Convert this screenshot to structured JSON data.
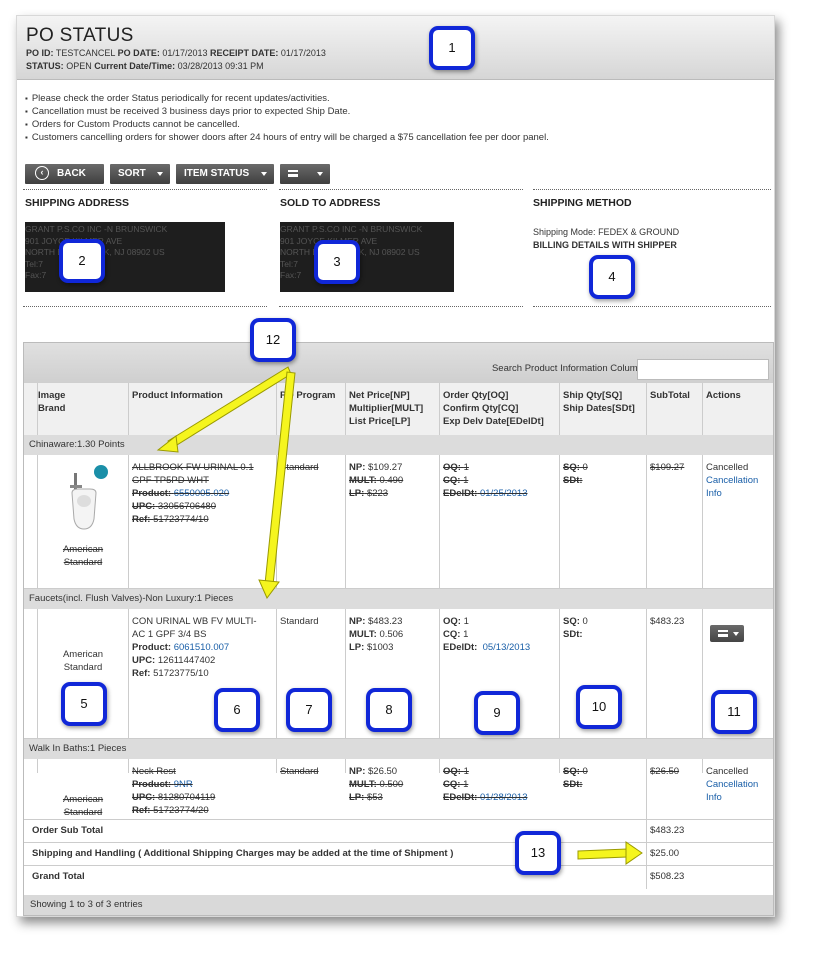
{
  "header": {
    "title": "PO STATUS",
    "po_id_label": "PO ID:",
    "po_id": "TESTCANCEL",
    "po_date_label": "PO DATE:",
    "po_date": "01/17/2013",
    "receipt_date_label": "RECEIPT DATE:",
    "receipt_date": "01/17/2013",
    "status_label": "STATUS:",
    "status": "OPEN",
    "current_label": "Current Date/Time:",
    "current": "03/28/2013 09:31 PM"
  },
  "notes": [
    "Please check the order Status periodically for recent updates/activities.",
    "Cancellation must be received 3 business days prior to expected Ship Date.",
    "Orders for Custom Products cannot be cancelled.",
    "Customers cancelling orders for shower doors after 24 hours of entry will be charged a $75 cancellation fee per door panel."
  ],
  "toolbar": {
    "back": "BACK",
    "sort": "SORT",
    "item_status": "ITEM STATUS"
  },
  "sections": {
    "shipping_address": "SHIPPING ADDRESS",
    "sold_to_address": "SOLD TO ADDRESS",
    "shipping_method": "SHIPPING METHOD",
    "shipping_addr_text": "GRANT P.S.CO INC -N BRUNSWICK\n901 JOYCE KILMER AVE\nNORTH BRUNSWICK, NJ 08902 US\nTel:7\nFax:7",
    "sold_to_addr_text": "GRANT P.S.CO INC -N BRUNSWICK\n901 JOYCE KILMER AVE\nNORTH BRUNSWICK, NJ 08902 US\nTel:7\nFax:7",
    "shipping_mode_label": "Shipping Mode:",
    "shipping_mode": "FEDEX & GROUND",
    "billing": "BILLING DETAILS WITH SHIPPER"
  },
  "table": {
    "search_label": "Search Product Information Column",
    "search_value": "",
    "columns": {
      "image_brand": [
        "Image",
        "Brand"
      ],
      "product_info": "Product Information",
      "po_program": "PO Program",
      "price": [
        "Net Price[NP]",
        "Multiplier[MULT]",
        "List Price[LP]"
      ],
      "order_qty": [
        "Order Qty[OQ]",
        "Confirm Qty[CQ]",
        "Exp Delv Date[EDelDt]"
      ],
      "ship_qty": [
        "Ship Qty[SQ]",
        "Ship Dates[SDt]"
      ],
      "subtotal": "SubTotal",
      "actions": "Actions"
    },
    "groups": [
      {
        "label": "Chinaware:1.30 Points",
        "brand": [
          "American",
          "Standard"
        ],
        "product": [
          "ALLBROOK FW URINAL 0.1",
          "GPF TP5PD WHT"
        ],
        "product_no_label": "Product:",
        "product_no": "6550005.020",
        "upc_label": "UPC:",
        "upc": "33056706480",
        "ref_label": "Ref:",
        "ref": "51723774/10",
        "program": "Standard",
        "np_label": "NP:",
        "np": "$109.27",
        "mult_label": "MULT:",
        "mult": "0.490",
        "lp_label": "LP:",
        "lp": "$223",
        "oq_label": "OQ:",
        "oq": "1",
        "cq_label": "CQ:",
        "cq": "1",
        "edeldt_label": "EDelDt:",
        "edeldt": "01/25/2013",
        "sq_label": "SQ:",
        "sq": "0",
        "sdt_label": "SDt:",
        "subtotal": "$109.27",
        "action_status": "Cancelled",
        "action_link": "Cancellation Info"
      },
      {
        "label": "Faucets(incl. Flush Valves)-Non Luxury:1 Pieces",
        "brand": [
          "American",
          "Standard"
        ],
        "product": [
          "CON URINAL WB FV MULTI-",
          "AC 1 GPF 3/4 BS"
        ],
        "product_no_label": "Product:",
        "product_no": "6061510.007",
        "upc_label": "UPC:",
        "upc": "12611447402",
        "ref_label": "Ref:",
        "ref": "51723775/10",
        "program": "Standard",
        "np_label": "NP:",
        "np": "$483.23",
        "mult_label": "MULT:",
        "mult": "0.506",
        "lp_label": "LP:",
        "lp": "$1003",
        "oq_label": "OQ:",
        "oq": "1",
        "cq_label": "CQ:",
        "cq": "1",
        "edeldt_label": "EDelDt:",
        "edeldt": "05/13/2013",
        "sq_label": "SQ:",
        "sq": "0",
        "sdt_label": "SDt:",
        "subtotal": "$483.23"
      },
      {
        "label": "Walk In Baths:1 Pieces",
        "brand": [
          "American",
          "Standard"
        ],
        "product": [
          "Neck Rest"
        ],
        "product_no_label": "Product:",
        "product_no": "9NR",
        "upc_label": "UPC:",
        "upc": "81280704119",
        "ref_label": "Ref:",
        "ref": "51723774/20",
        "program": "Standard",
        "np_label": "NP:",
        "np": "$26.50",
        "mult_label": "MULT:",
        "mult": "0.500",
        "lp_label": "LP:",
        "lp": "$53",
        "oq_label": "OQ:",
        "oq": "1",
        "cq_label": "CQ:",
        "cq": "1",
        "edeldt_label": "EDelDt:",
        "edeldt": "01/28/2013",
        "sq_label": "SQ:",
        "sq": "0",
        "sdt_label": "SDt:",
        "subtotal": "$26.50",
        "action_status": "Cancelled",
        "action_link": "Cancellation Info"
      }
    ],
    "totals": {
      "order_sub_total_label": "Order Sub Total",
      "order_sub_total": "$483.23",
      "shipping_label": "Shipping and Handling ( Additional Shipping Charges may be added at the time of Shipment )",
      "shipping": "$25.00",
      "grand_total_label": "Grand Total",
      "grand_total": "$508.23"
    },
    "footer": "Showing 1 to 3 of 3 entries"
  },
  "callouts": [
    "1",
    "2",
    "3",
    "4",
    "5",
    "6",
    "7",
    "8",
    "9",
    "10",
    "11",
    "12",
    "13"
  ],
  "colors": {
    "callout_border": "#1027d8",
    "arrow": "#f5f51e",
    "link": "#1a5fa8"
  }
}
